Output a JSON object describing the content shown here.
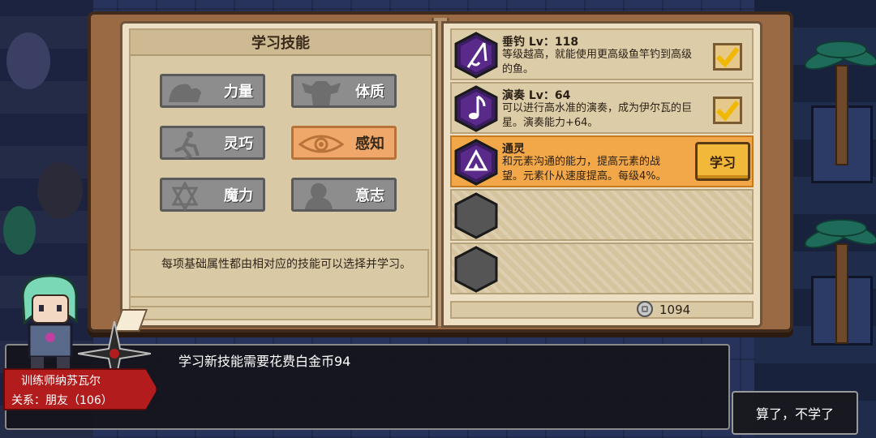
{
  "book": {
    "title": "学习技能",
    "attributes": [
      {
        "label": "力量",
        "icon": "arm-icon",
        "active": false
      },
      {
        "label": "体质",
        "icon": "torso-icon",
        "active": false
      },
      {
        "label": "灵巧",
        "icon": "runner-icon",
        "active": false
      },
      {
        "label": "感知",
        "icon": "eye-icon",
        "active": true
      },
      {
        "label": "魔力",
        "icon": "hexagram-icon",
        "active": false
      },
      {
        "label": "意志",
        "icon": "head-icon",
        "active": false
      }
    ],
    "description": "每项基础属性都由相对应的技能可以选择并学习。"
  },
  "skills": [
    {
      "name": "垂钓 Lv：118",
      "desc": "等级越高，就能使用更高级鱼竿钓到高级的鱼。",
      "icon": "fishing-rod-icon",
      "state": "learned"
    },
    {
      "name": "演奏 Lv：64",
      "desc": "可以进行高水准的演奏，成为伊尔瓦的巨星。演奏能力+64。",
      "icon": "music-note-icon",
      "state": "learned"
    },
    {
      "name": "通灵",
      "desc": "和元素沟通的能力，提高元素的战望。元素仆从速度提高。每级4%。",
      "icon": "triforce-icon",
      "state": "learnable",
      "action": "学习"
    },
    {
      "name": "",
      "desc": "",
      "icon": "empty-hex-icon",
      "state": "empty"
    },
    {
      "name": "",
      "desc": "",
      "icon": "empty-hex-icon",
      "state": "empty"
    }
  ],
  "currency": {
    "icon": "platinum-coin-icon",
    "amount": "1094"
  },
  "dialog": {
    "text": "学习新技能需要花费白金币94",
    "npc_name": "训练师纳苏瓦尔",
    "npc_relation": "关系：朋友（106）",
    "cancel_label": "算了，不学了"
  },
  "colors": {
    "selected_row": "#f2a848",
    "active_attribute": "#f0a86a",
    "inactive_attribute": "#8d8d8d",
    "skill_icon_purple": "#4a1f78",
    "name_plate_red": "#b21c1c"
  }
}
